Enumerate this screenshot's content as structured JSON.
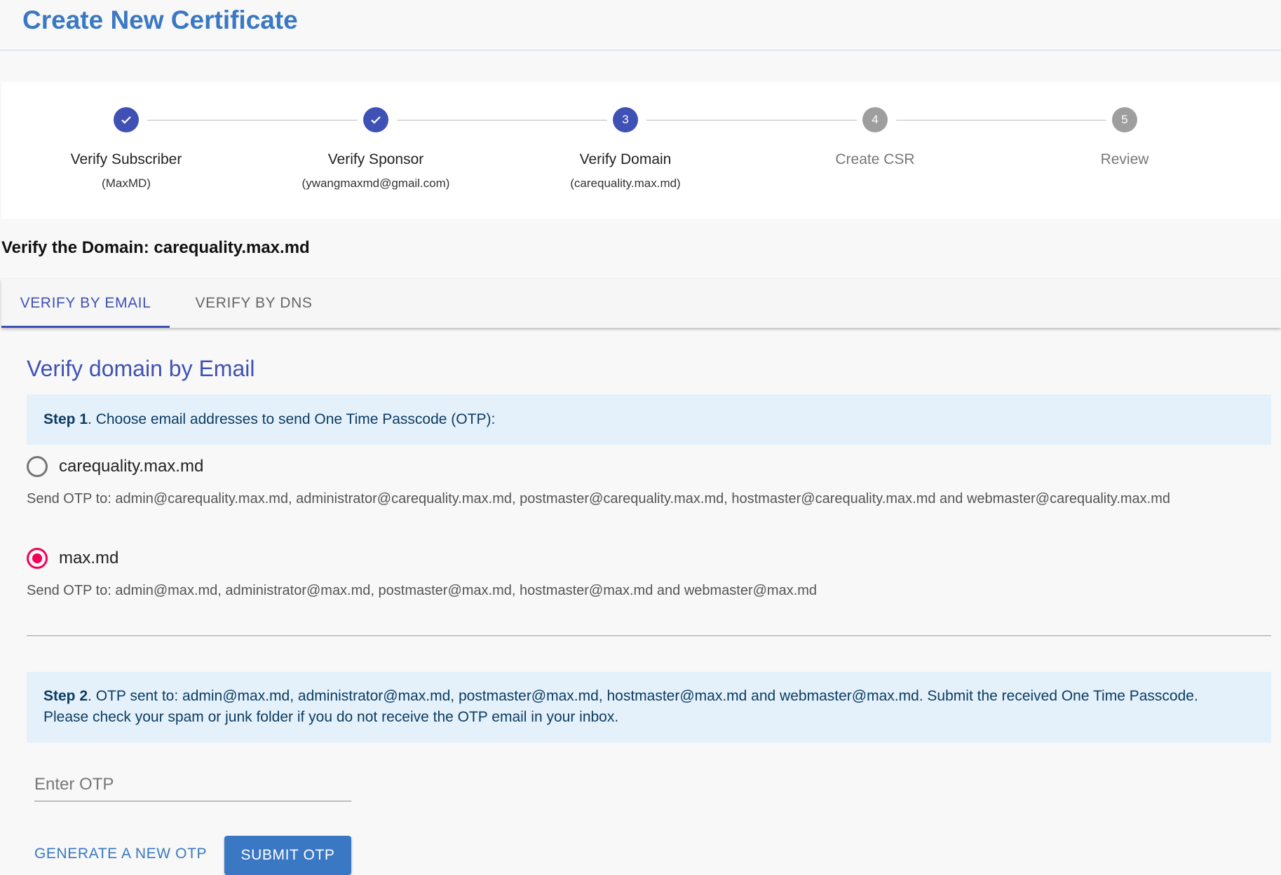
{
  "page": {
    "title": "Create New Certificate"
  },
  "stepper": {
    "steps": [
      {
        "number": "1",
        "label": "Verify Subscriber",
        "sub": "(MaxMD)",
        "state": "done"
      },
      {
        "number": "2",
        "label": "Verify Sponsor",
        "sub": "(ywangmaxmd@gmail.com)",
        "state": "done"
      },
      {
        "number": "3",
        "label": "Verify Domain",
        "sub": "(carequality.max.md)",
        "state": "active"
      },
      {
        "number": "4",
        "label": "Create CSR",
        "sub": "",
        "state": "todo"
      },
      {
        "number": "5",
        "label": "Review",
        "sub": "",
        "state": "todo"
      }
    ]
  },
  "domain_heading": "Verify the Domain: carequality.max.md",
  "tabs": [
    {
      "label": "VERIFY BY EMAIL",
      "selected": true
    },
    {
      "label": "VERIFY BY DNS",
      "selected": false
    }
  ],
  "email_section": {
    "title": "Verify domain by Email",
    "step1": {
      "prefix": "Step 1",
      "text": ". Choose email addresses to send One Time Passcode (OTP):"
    },
    "options": [
      {
        "label": "carequality.max.md",
        "checked": false,
        "description": "Send OTP to: admin@carequality.max.md, administrator@carequality.max.md, postmaster@carequality.max.md, hostmaster@carequality.max.md and webmaster@carequality.max.md"
      },
      {
        "label": "max.md",
        "checked": true,
        "description": "Send OTP to: admin@max.md, administrator@max.md, postmaster@max.md, hostmaster@max.md and webmaster@max.md"
      }
    ],
    "step2": {
      "prefix": "Step 2",
      "text": ". OTP sent to: admin@max.md, administrator@max.md, postmaster@max.md, hostmaster@max.md and webmaster@max.md. Submit the received One Time Passcode.",
      "note": "Please check your spam or junk folder if you do not receive the OTP email in your inbox."
    },
    "otp_input": {
      "placeholder": "Enter OTP",
      "value": ""
    },
    "generate_label": "GENERATE A NEW OTP",
    "submit_label": "SUBMIT OTP"
  },
  "colors": {
    "primary": "#3f51b5",
    "brand_blue": "#3a78c3",
    "radio_selected": "#f50057",
    "step_inactive": "#9e9e9e",
    "info_bg": "#e4f1fb"
  }
}
